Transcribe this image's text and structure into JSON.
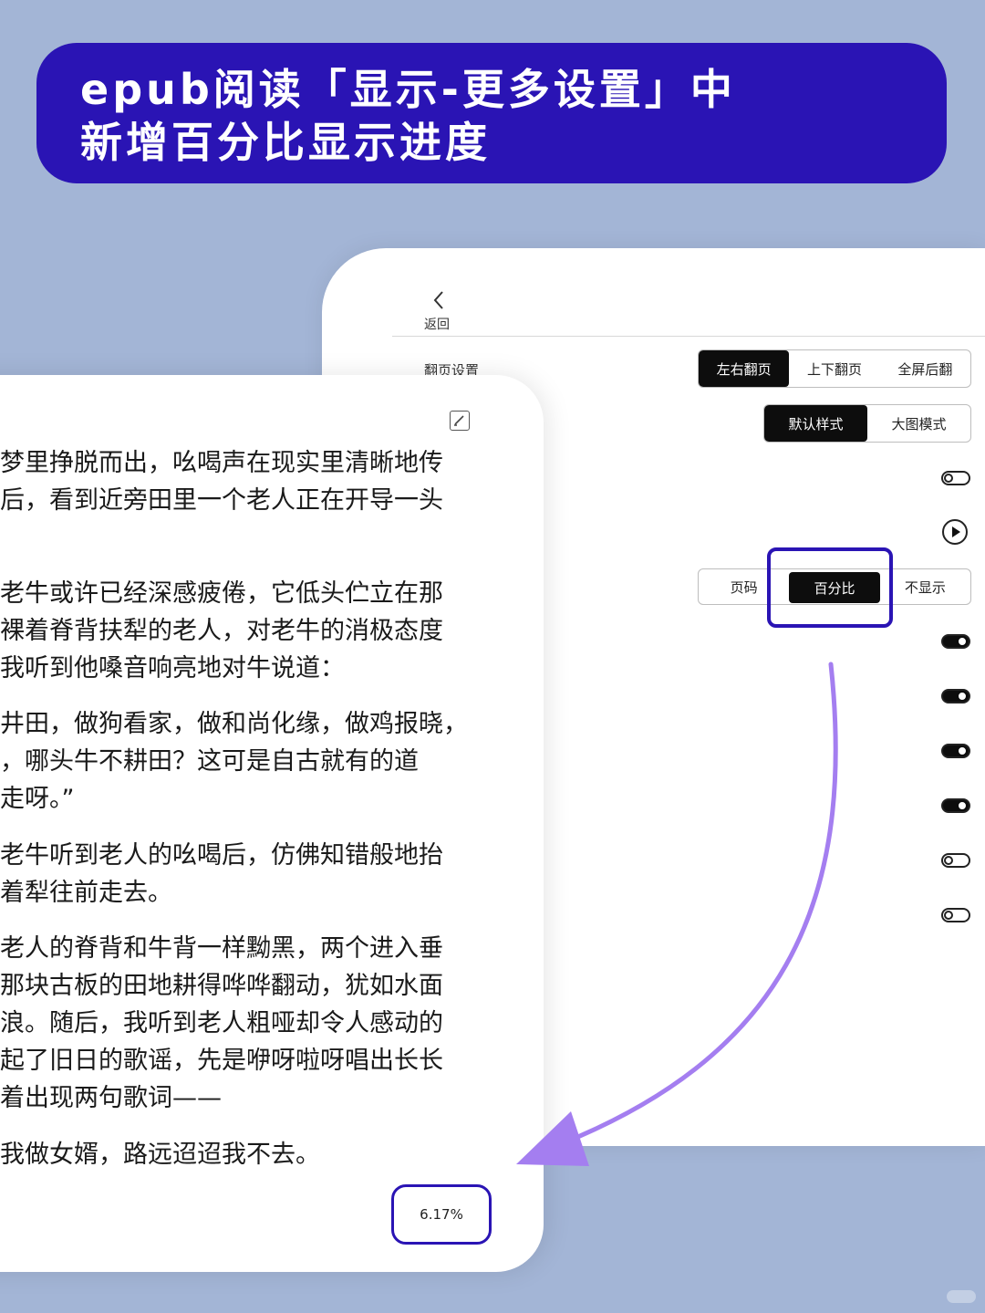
{
  "banner": {
    "line1": "epub阅读「显示-更多设置」中",
    "line2": "新增百分比显示进度"
  },
  "settings": {
    "back_label": "返回",
    "page_turn_label": "翻页设置",
    "page_turn_options": [
      "左右翻页",
      "上下翻页",
      "全屏后翻"
    ],
    "page_turn_selected": "左右翻页",
    "style_options": [
      "默认样式",
      "大图模式"
    ],
    "style_selected": "默认样式",
    "progress_options": [
      "页码",
      "百分比",
      "不显示"
    ],
    "progress_selected": "百分比",
    "toggles": [
      {
        "state": "off"
      },
      {
        "state": "on"
      },
      {
        "state": "on"
      },
      {
        "state": "on"
      },
      {
        "state": "on"
      },
      {
        "state": "off"
      },
      {
        "state": "off"
      }
    ]
  },
  "reader": {
    "paragraphs": [
      [
        "梦里挣脱而出，吆喝声在现实里清晰地传",
        "后，看到近旁田里一个老人正在开导一头"
      ],
      [
        "老牛或许已经深感疲倦，它低头伫立在那",
        "裸着脊背扶犁的老人，对老牛的消极态度",
        "我听到他嗓音响亮地对牛说道："
      ],
      [
        "井田，做狗看家，做和尚化缘，做鸡报晓，",
        "，哪头牛不耕田？这可是自古就有的道",
        "走呀。”"
      ],
      [
        "老牛听到老人的吆喝后，仿佛知错般地抬",
        "着犁往前走去。"
      ],
      [
        "老人的脊背和牛背一样黝黑，两个进入垂",
        "那块古板的田地耕得哗哗翻动，犹如水面",
        "浪。随后，我听到老人粗哑却令人感动的",
        "起了旧日的歌谣，先是咿呀啦呀唱出长长",
        "着出现两句歌词——"
      ],
      [
        "我做女婿，路远迢迢我不去。"
      ]
    ],
    "progress_value": "6.17%"
  },
  "colors": {
    "background": "#a3b5d6",
    "banner": "#2a14b4",
    "highlight": "#2a14b4",
    "arrow": "#a47ef0"
  }
}
